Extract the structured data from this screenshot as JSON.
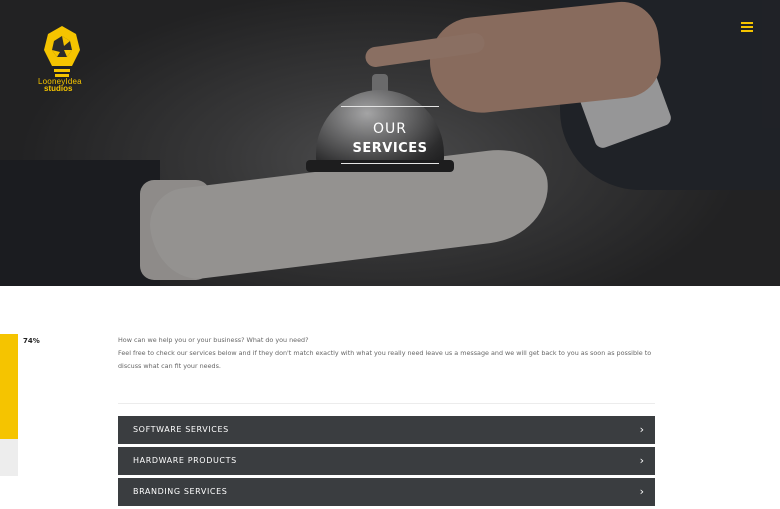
{
  "brand": {
    "name_line1": "LooneyIdea",
    "name_line2": "studios",
    "accent_color": "#f5c400"
  },
  "header": {
    "menu_icon": "hamburger-menu-icon"
  },
  "hero": {
    "title_line1": "OUR",
    "title_line2": "SERVICES"
  },
  "progress": {
    "label": "74%",
    "value": 0.74
  },
  "intro": {
    "line1": "How can we help you or your business? What do you need?",
    "line2": "Feel free to check our services below and if they don't match exactly with what you really need leave us a message and we will get back to you as soon as possible to discuss what can fit your needs."
  },
  "services": [
    {
      "label": "SOFTWARE SERVICES",
      "icon": "chevron-right-icon"
    },
    {
      "label": "HARDWARE PRODUCTS",
      "icon": "chevron-right-icon"
    },
    {
      "label": "BRANDING SERVICES",
      "icon": "chevron-right-icon"
    }
  ]
}
